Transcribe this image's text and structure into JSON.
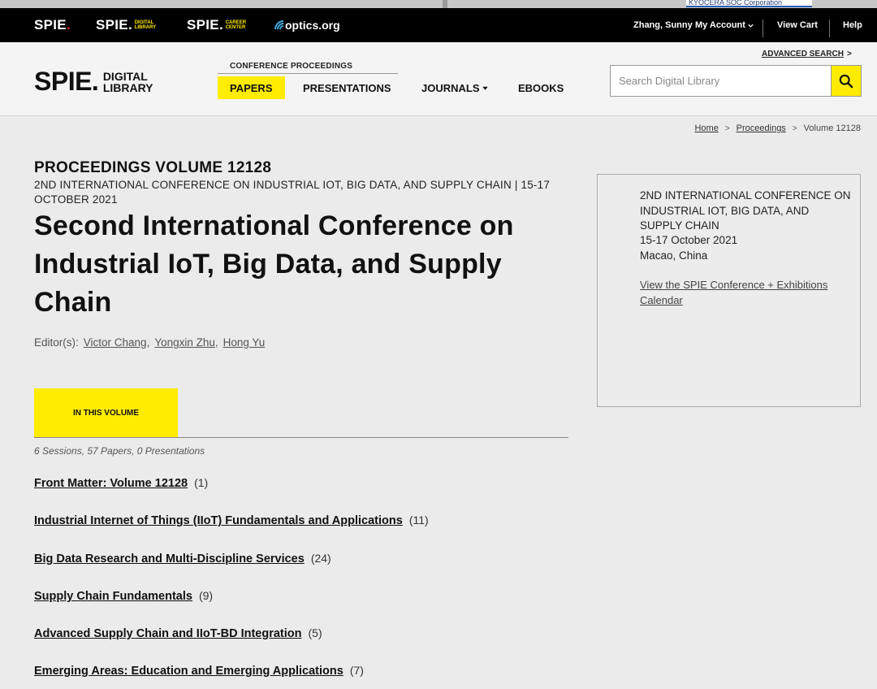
{
  "top_ad": {
    "text": "KYOCERA SOC Corporation"
  },
  "topbar": {
    "brands": [
      {
        "word": "SPIE",
        "sub": ""
      },
      {
        "word": "SPIE",
        "sub": "DIGITAL LIBRARY"
      },
      {
        "word": "SPIE",
        "sub": "CAREER CENTER"
      }
    ],
    "optics": "optics.org",
    "user_name": "Zhang, Sunny",
    "my_account": "My Account",
    "view_cart": "View Cart",
    "help": "Help"
  },
  "header": {
    "logo_word": "SPIE",
    "logo_line1": "DIGITAL",
    "logo_line2": "LIBRARY",
    "conference_proceedings": "CONFERENCE PROCEEDINGS",
    "nav": {
      "papers": "PAPERS",
      "presentations": "PRESENTATIONS",
      "journals": "JOURNALS",
      "ebooks": "EBOOKS"
    },
    "advanced_search": "ADVANCED SEARCH",
    "search_placeholder": "Search Digital Library"
  },
  "breadcrumb": {
    "home": "Home",
    "proceedings": "Proceedings",
    "current": "Volume 12128"
  },
  "main": {
    "volume_label": "PROCEEDINGS VOLUME 12128",
    "conference_subtitle": "2ND INTERNATIONAL CONFERENCE ON INDUSTRIAL IOT, BIG DATA, AND SUPPLY CHAIN | 15-17 OCTOBER 2021",
    "title": "Second International Conference on Industrial IoT, Big Data, and Supply Chain",
    "editors_label": "Editor(s):",
    "editors": [
      "Victor Chang",
      "Yongxin Zhu",
      "Hong Yu"
    ],
    "tab_label": "IN THIS VOLUME",
    "counts": "6 Sessions, 57 Papers, 0 Presentations",
    "sessions": [
      {
        "title": "Front Matter: Volume 12128",
        "count": "(1)"
      },
      {
        "title": "Industrial Internet of Things (IIoT) Fundamentals and Applications",
        "count": "(11)"
      },
      {
        "title": "Big Data Research and Multi-Discipline Services",
        "count": "(24)"
      },
      {
        "title": "Supply Chain Fundamentals",
        "count": "(9)"
      },
      {
        "title": "Advanced Supply Chain and IIoT-BD Integration",
        "count": "(5)"
      },
      {
        "title": "Emerging Areas: Education and Emerging Applications",
        "count": "(7)"
      }
    ]
  },
  "panel": {
    "conference_name": "2ND INTERNATIONAL CONFERENCE ON INDUSTRIAL IOT, BIG DATA, AND SUPPLY CHAIN",
    "dates": "15-17 October 2021",
    "location": "Macao, China",
    "calendar_link": "View the SPIE Conference + Exhibitions Calendar"
  },
  "colors": {
    "accent_yellow": "#ffec00",
    "spie_red": "#e8332a",
    "topbar_black": "#000000"
  },
  "icons": {
    "search": "search-icon",
    "optics_logo": "optics-wave-icon",
    "chevron": "chevron-down-icon"
  }
}
